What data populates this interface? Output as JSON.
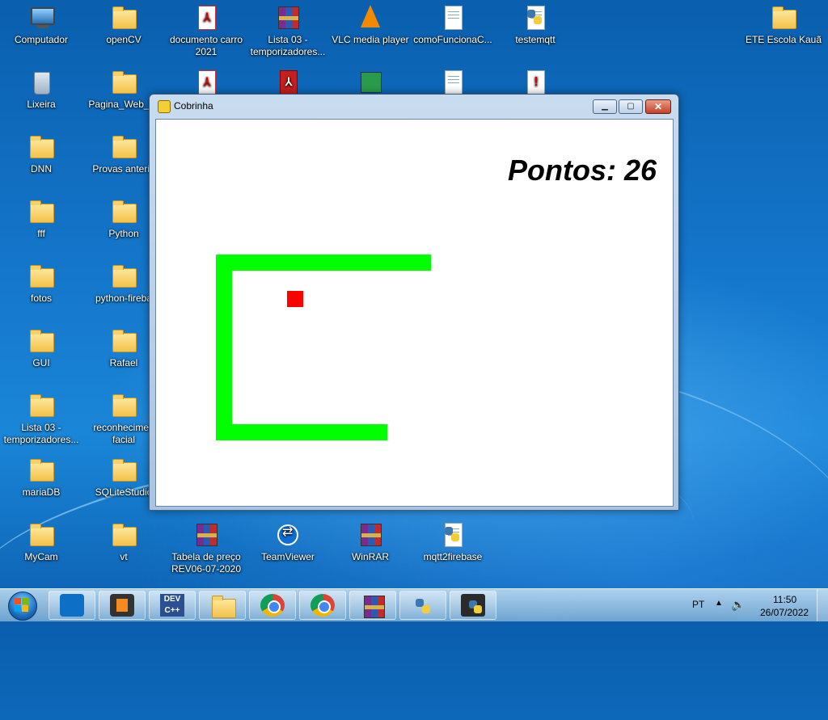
{
  "desktop": {
    "icons": [
      {
        "label": "Computador"
      },
      {
        "label": "openCV"
      },
      {
        "label": "documento carro 2021"
      },
      {
        "label": "Lista 03 - temporizadores..."
      },
      {
        "label": "VLC media player"
      },
      {
        "label": "comoFuncionaC..."
      },
      {
        "label": "testemqtt"
      },
      {
        "label": "ETE Escola Kauã"
      },
      {
        "label": "Lixeira"
      },
      {
        "label": "Pagina_Web_Pr"
      },
      {
        "label": "DNN"
      },
      {
        "label": "Provas anterio"
      },
      {
        "label": "fff"
      },
      {
        "label": "Python"
      },
      {
        "label": "fotos"
      },
      {
        "label": "python-fireba"
      },
      {
        "label": "GUI"
      },
      {
        "label": "Rafael"
      },
      {
        "label": "Lista 03 - temporizadores..."
      },
      {
        "label": "reconhecimen facial"
      },
      {
        "label": "mariaDB"
      },
      {
        "label": "SQLiteStudio"
      },
      {
        "label": "MyCam"
      },
      {
        "label": "vt"
      },
      {
        "label": "Tabela de preço REV06-07-2020"
      },
      {
        "label": "TeamViewer"
      },
      {
        "label": "WinRAR"
      },
      {
        "label": "mqtt2firebase"
      }
    ]
  },
  "window": {
    "title": "Cobrinha",
    "score_text": "Pontos: 26",
    "snake_color": "#00ff00",
    "food_color": "#ff0000",
    "buttons": {
      "minimize": "minimize",
      "maximize": "maximize",
      "close": "close"
    }
  },
  "taskbar": {
    "pinned": [
      {
        "name": "visual-studio-code"
      },
      {
        "name": "sublime-text"
      },
      {
        "name": "dev-cpp"
      },
      {
        "name": "file-explorer"
      },
      {
        "name": "chrome"
      },
      {
        "name": "chrome"
      },
      {
        "name": "winrar"
      },
      {
        "name": "python-launcher"
      },
      {
        "name": "python-idle"
      }
    ],
    "language": "PT",
    "time": "11:50",
    "date": "26/07/2022"
  }
}
